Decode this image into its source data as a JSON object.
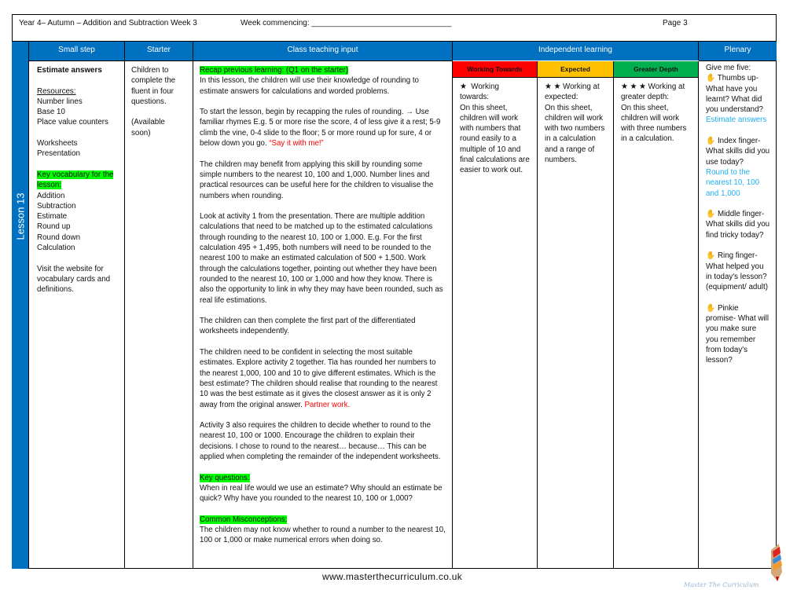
{
  "header": {
    "title": "Year 4– Autumn – Addition and Subtraction Week 3",
    "week": "Week commencing: ________________________________",
    "page": "Page 3"
  },
  "columns": [
    "Small step",
    "Starter",
    "Class teaching input",
    "Independent learning",
    "Plenary"
  ],
  "lesson": "Lesson 13",
  "small_step": {
    "title": "Estimate answers",
    "resources_label": "Resources:",
    "resources": [
      "Number lines",
      "Base 10",
      "Place value counters"
    ],
    "materials": [
      "Worksheets",
      "Presentation"
    ],
    "vocab_label": "Key vocabulary for the lesson:",
    "vocab": [
      "Addition",
      "Subtraction",
      "Estimate",
      "Round up",
      "Round down",
      "Calculation"
    ],
    "website": "Visit the website for vocabulary cards and definitions."
  },
  "starter": {
    "text": "Children to complete the fluent in four questions.",
    "note": "(Available soon)"
  },
  "teaching": {
    "recap_label": "Recap previous learning: (Q1 on the starter)",
    "p1": "In this lesson, the children will use their knowledge of rounding to estimate answers for calculations and worded problems.",
    "p2": "To start the lesson, begin by recapping the rules of rounding. → Use familiar rhymes E.g. 5 or more rise the score, 4 of less give it a rest; 5-9 climb the vine, 0-4 slide to the floor; 5 or more round up for sure, 4 or below down you go. ",
    "p2_red": "“Say it with me!”",
    "p3": "The children may benefit from applying this skill by rounding some simple numbers to the nearest 10, 100 and 1,000. Number lines and practical resources can be useful here for the children to visualise the numbers when rounding.",
    "p4": "Look at activity 1 from the presentation. There are multiple addition calculations that need to be matched up to the estimated calculations through rounding to the nearest 10, 100 or 1,000. E.g. For the first calculation 495 + 1,495, both numbers will need to be rounded to the nearest 100 to make an estimated calculation of 500 + 1,500. Work through the calculations together, pointing out whether they have been rounded to the nearest 10, 100 or 1,000 and how they know. There is also the opportunity to link in why they may have been rounded, such as real life estimations.",
    "p5": "The children can then complete the first part of the differentiated worksheets independently.",
    "p6": "The children need to be confident in selecting the most suitable estimates. Explore activity 2 together. Tia has rounded her numbers to the nearest 1,000, 100 and 10 to give different estimates. Which is the best estimate? The children should realise that rounding to the nearest 10 was the best estimate as it gives the closest answer as it is only 2 away from the  original answer. ",
    "p6_red": "Partner work.",
    "p7": "Activity 3 also requires the children to decide whether to round to the nearest 10, 100 or 1000. Encourage the children to explain their decisions. I chose to round to the nearest… because… This can be applied when completing the remainder of the independent worksheets.",
    "kq_label": "Key questions:",
    "kq": "When in real life would we use an estimate? Why should an estimate be quick? Why have you rounded to the nearest 10, 100 or 1,000?",
    "cm_label": "Common Misconceptions:",
    "cm": "The children may not know whether to round a number to the nearest 10, 100 or 1,000 or make numerical errors when doing so."
  },
  "independent": [
    {
      "label": "Working Towards",
      "color": "#ff0000",
      "stars": "★",
      "text": "Working towards:",
      "body": "On this sheet, children will work with numbers that round easily to a multiple of 10 and final calculations are easier to work out."
    },
    {
      "label": "Expected",
      "color": "#ffc000",
      "stars": "★ ★",
      "text": "Working at expected:",
      "body": "On this sheet, children will work with two numbers in a calculation and a range of numbers."
    },
    {
      "label": "Greater Depth",
      "color": "#00b050",
      "stars": "★ ★ ★",
      "text": "Working at greater depth:",
      "body": "On this sheet, children will work with three numbers in a calculation."
    }
  ],
  "plenary": {
    "intro": "Give me five:",
    "items": [
      {
        "icon": "hand-icon",
        "q": "Thumbs up- What have you learnt? What did you understand?",
        "a": "Estimate answers"
      },
      {
        "icon": "hand-icon",
        "q": "Index finger- What skills did you use today?",
        "a": "Round to the nearest 10, 100 and 1,000"
      },
      {
        "icon": "hand-icon",
        "q": "Middle finger- What skills did you find tricky today?",
        "a": ""
      },
      {
        "icon": "hand-icon",
        "q": "Ring finger- What helped you in today's lesson? (equipment/ adult)",
        "a": ""
      },
      {
        "icon": "hand-icon",
        "q": "Pinkie promise- What will you make sure you remember from today's lesson?",
        "a": ""
      }
    ]
  },
  "footer": "www.masterthecurriculum.co.uk",
  "logo": "Master The Curriculum",
  "colors": {
    "header_blue": "#0070c0",
    "highlight": "#00ff00",
    "red": "#ff0000",
    "blue_text": "#1fb0f0"
  }
}
